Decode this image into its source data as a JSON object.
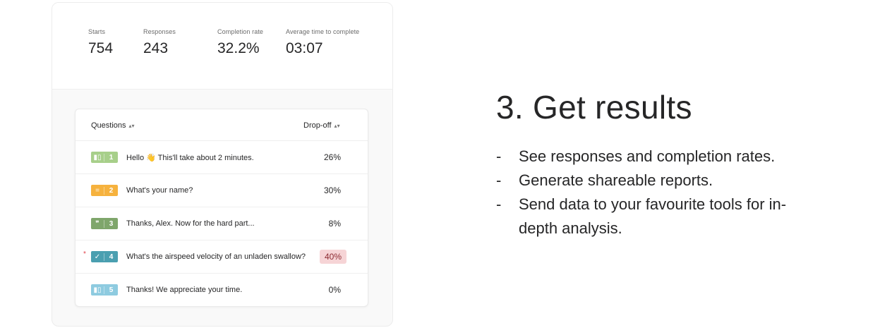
{
  "stats": [
    {
      "label": "Starts",
      "value": "754"
    },
    {
      "label": "Responses",
      "value": "243"
    },
    {
      "label": "Completion rate",
      "value": "32.2%"
    },
    {
      "label": "Average time to complete",
      "value": "03:07"
    }
  ],
  "table": {
    "col_questions": "Questions",
    "col_dropoff": "Drop-off",
    "rows": [
      {
        "num": "1",
        "text": "Hello 👋  This'll take about 2 minutes.",
        "dropoff": "26%",
        "color": "#a7cf8a",
        "icon": "welcome-screen-icon",
        "glyph": "▮▯"
      },
      {
        "num": "2",
        "text": "What's your name?",
        "dropoff": "30%",
        "color": "#f6b23e",
        "icon": "short-text-icon",
        "glyph": "="
      },
      {
        "num": "3",
        "text": "Thanks, Alex. Now for the hard part...",
        "dropoff": "8%",
        "color": "#7fa66b",
        "icon": "quote-icon",
        "glyph": "❞"
      },
      {
        "num": "4",
        "text": "What's the airspeed velocity of an unladen swallow?",
        "dropoff": "40%",
        "color": "#4a9fb0",
        "icon": "checkmark-icon",
        "glyph": "✓",
        "highlight": true,
        "required": "*"
      },
      {
        "num": "5",
        "text": "Thanks! We appreciate your time.",
        "dropoff": "0%",
        "color": "#8ecbe0",
        "icon": "end-screen-icon",
        "glyph": "▮▯"
      }
    ]
  },
  "heading": "3. Get results",
  "bullets": [
    {
      "dash": "-",
      "text": "See responses and completion rates."
    },
    {
      "dash": "-",
      "text": "Generate shareable reports."
    },
    {
      "dash": "-",
      "text": "Send data to your favourite tools for in-depth analysis."
    }
  ]
}
